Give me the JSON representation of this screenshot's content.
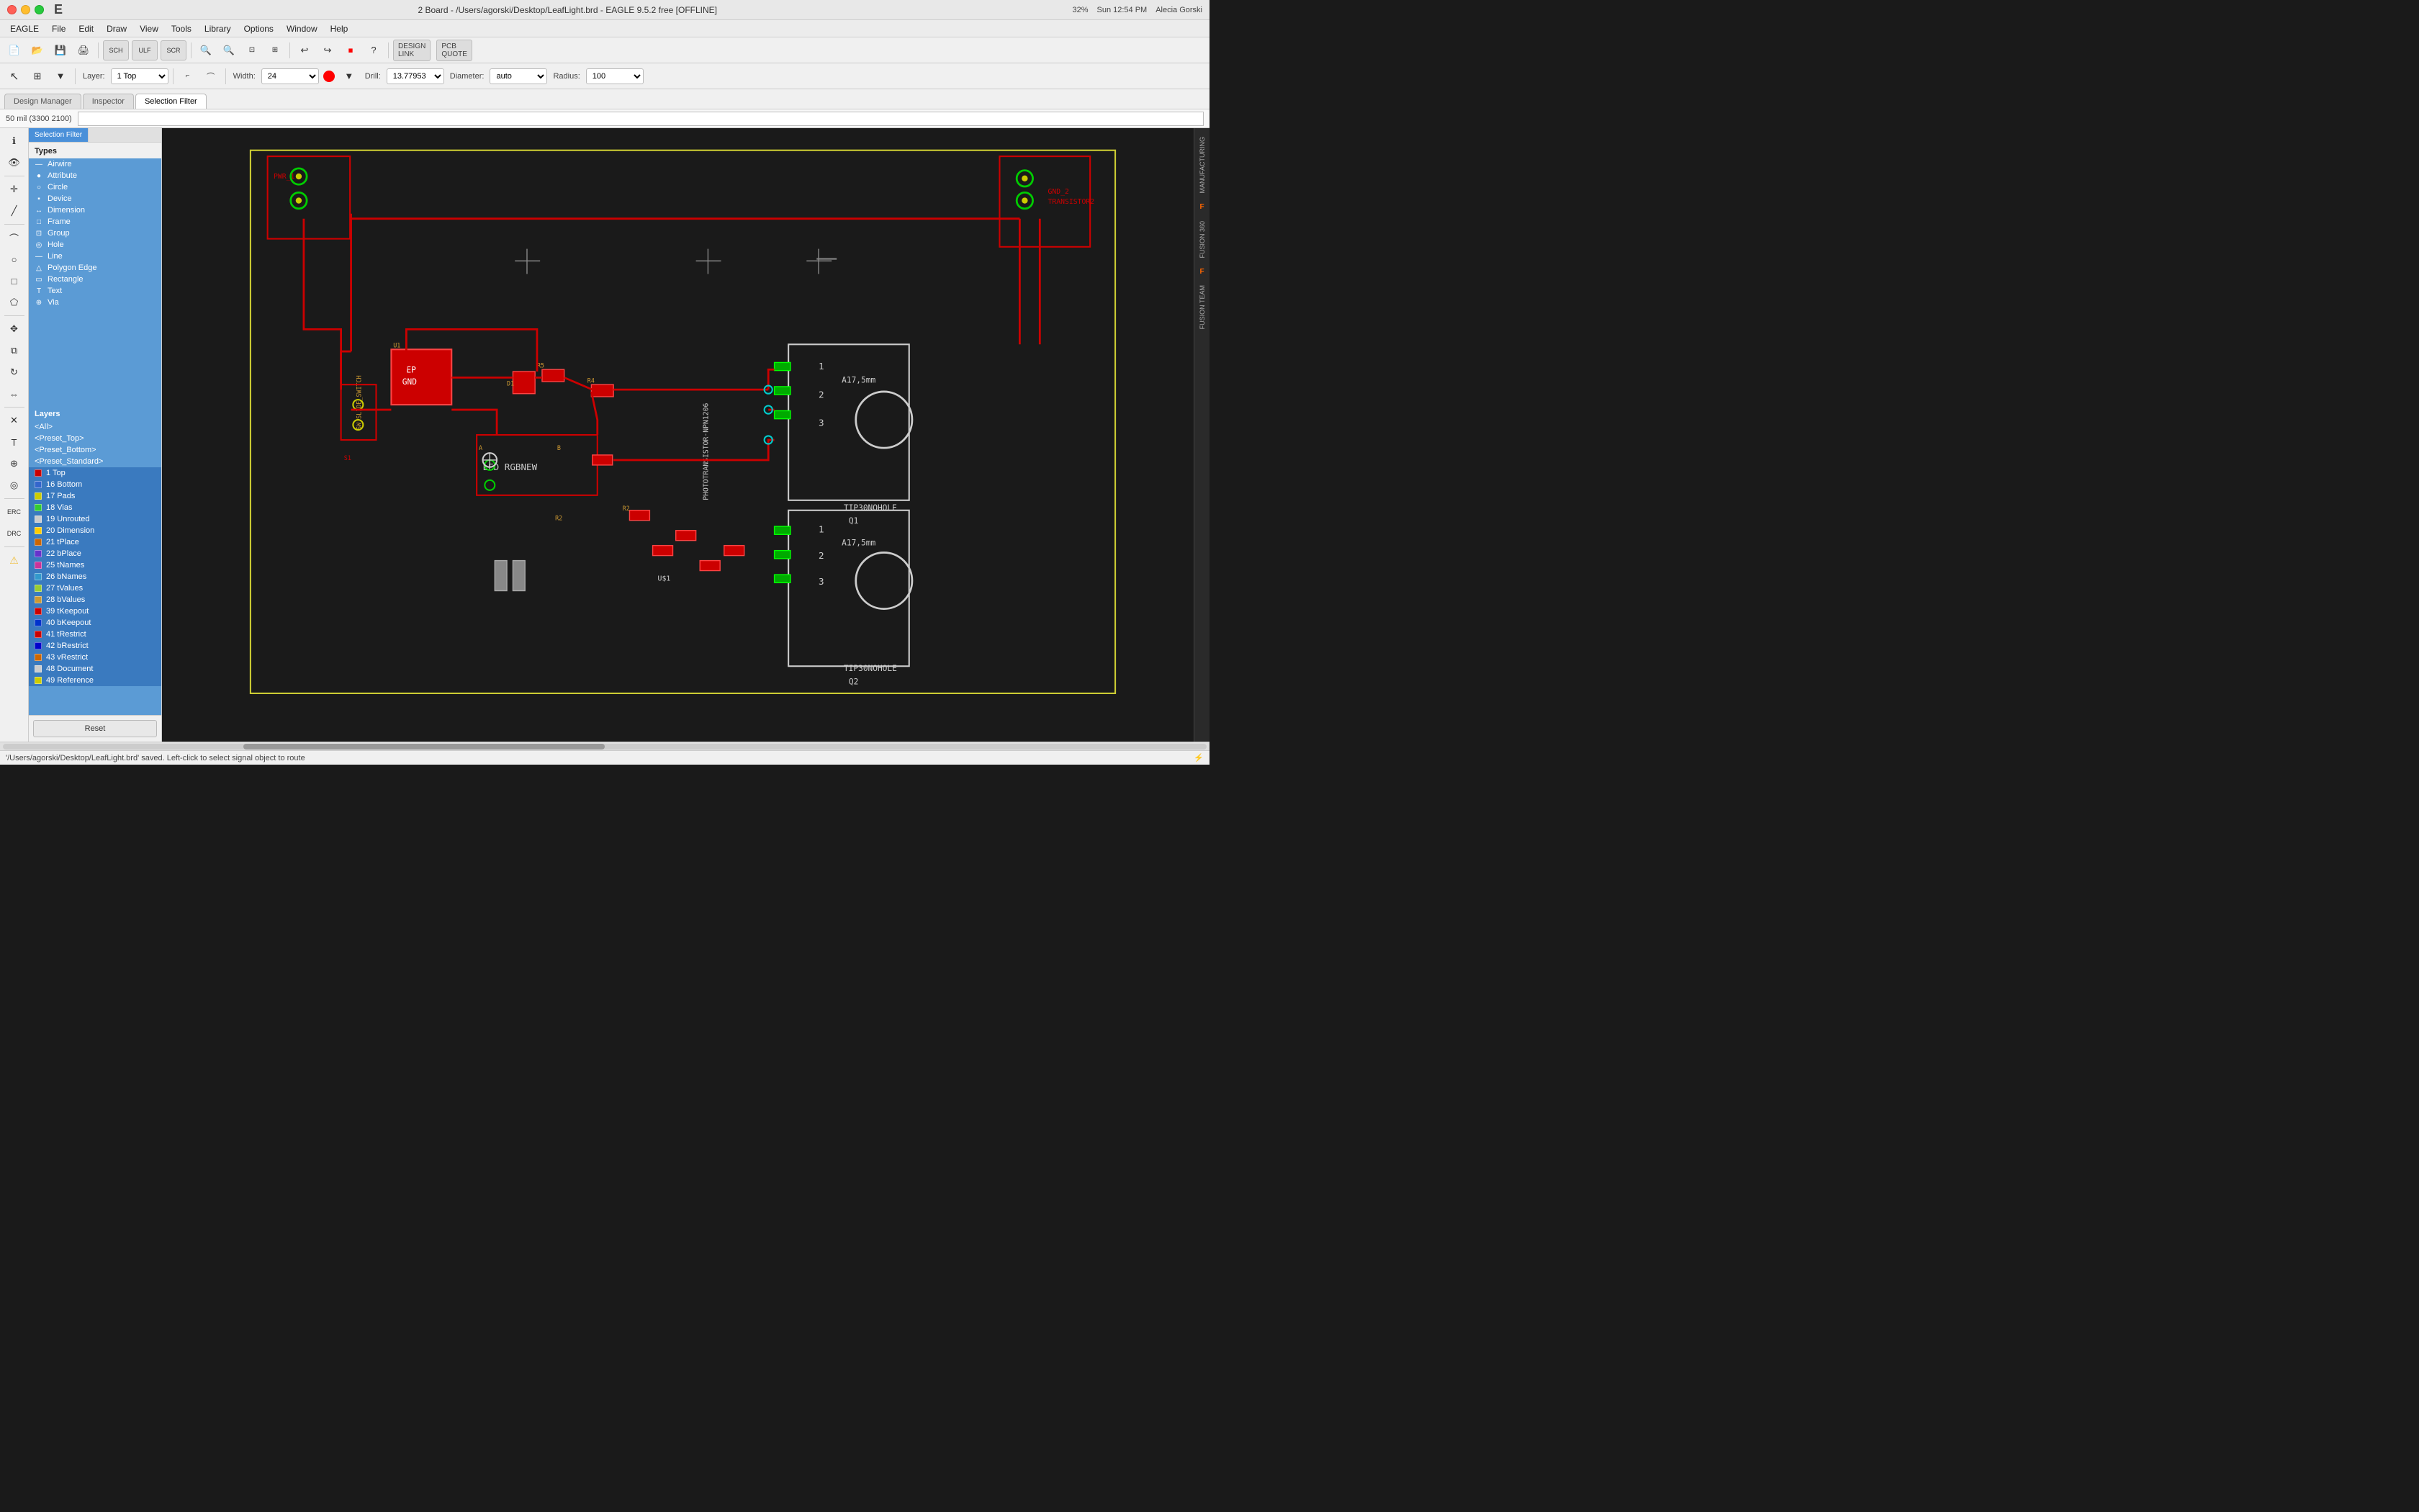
{
  "titlebar": {
    "title": "2 Board - /Users/agorski/Desktop/LeafLight.brd - EAGLE 9.5.2 free [OFFLINE]",
    "right": {
      "battery": "32%",
      "time": "Sun 12:54 PM",
      "user": "Alecia Gorski"
    }
  },
  "menubar": {
    "items": [
      "EAGLE",
      "File",
      "Edit",
      "Draw",
      "View",
      "Tools",
      "Library",
      "Options",
      "Window",
      "Help"
    ]
  },
  "toolbar_main": {
    "layer_label": "Layer:",
    "layer_value": "1 Top",
    "width_label": "Width:",
    "width_value": "24",
    "drill_label": "Drill:",
    "drill_value": "13.77953",
    "diameter_label": "Diameter:",
    "diameter_value": "auto",
    "radius_label": "Radius:",
    "radius_value": "100",
    "design_link": "DESIGN LINK",
    "pcb_quote": "PCB QUOTE"
  },
  "tabs": {
    "design_manager": "Design Manager",
    "inspector": "Inspector",
    "selection_filter": "Selection Filter"
  },
  "coord_bar": {
    "coords": "50 mil (3300 2100)"
  },
  "types": {
    "title": "Types",
    "items": [
      {
        "name": "Airwire",
        "icon": "~"
      },
      {
        "name": "Attribute",
        "icon": "●"
      },
      {
        "name": "Circle",
        "icon": "○"
      },
      {
        "name": "Device",
        "icon": "▪"
      },
      {
        "name": "Dimension",
        "icon": "↔"
      },
      {
        "name": "Frame",
        "icon": "□"
      },
      {
        "name": "Group",
        "icon": "⊡"
      },
      {
        "name": "Hole",
        "icon": "◎"
      },
      {
        "name": "Line",
        "icon": "—"
      },
      {
        "name": "Polygon Edge",
        "icon": "△"
      },
      {
        "name": "Rectangle",
        "icon": "▭"
      },
      {
        "name": "Text",
        "icon": "T"
      },
      {
        "name": "Via",
        "icon": "⊕"
      }
    ]
  },
  "layers": {
    "title": "Layers",
    "presets": [
      "<All>",
      "<Preset_Top>",
      "<Preset_Bottom>",
      "<Preset_Standard>"
    ],
    "items": [
      {
        "num": "1",
        "name": "Top",
        "color": "#cc0000",
        "highlighted": true
      },
      {
        "num": "16",
        "name": "Bottom",
        "color": "#3366cc",
        "highlighted": true
      },
      {
        "num": "17",
        "name": "Pads",
        "color": "#cccc00",
        "highlighted": true
      },
      {
        "num": "18",
        "name": "Vias",
        "color": "#33cc33",
        "highlighted": true
      },
      {
        "num": "19",
        "name": "Unrouted",
        "color": "#cccccc",
        "highlighted": true
      },
      {
        "num": "20",
        "name": "Dimension",
        "color": "#ffcc00",
        "highlighted": true
      },
      {
        "num": "21",
        "name": "tPlace",
        "color": "#cc6600",
        "highlighted": true
      },
      {
        "num": "22",
        "name": "bPlace",
        "color": "#6633cc",
        "highlighted": true
      },
      {
        "num": "25",
        "name": "tNames",
        "color": "#cc3399",
        "highlighted": true
      },
      {
        "num": "26",
        "name": "bNames",
        "color": "#3399cc",
        "highlighted": true
      },
      {
        "num": "27",
        "name": "tValues",
        "color": "#99cc33",
        "highlighted": true
      },
      {
        "num": "28",
        "name": "bValues",
        "color": "#cc9933",
        "highlighted": true
      },
      {
        "num": "39",
        "name": "tKeepout",
        "color": "#cc0000",
        "highlighted": true
      },
      {
        "num": "40",
        "name": "bKeepout",
        "color": "#0033cc",
        "highlighted": true
      },
      {
        "num": "41",
        "name": "tRestrict",
        "color": "#cc0000",
        "highlighted": true
      },
      {
        "num": "42",
        "name": "bRestrict",
        "color": "#0000cc",
        "highlighted": true
      },
      {
        "num": "43",
        "name": "vRestrict",
        "color": "#cc6600",
        "highlighted": true
      },
      {
        "num": "48",
        "name": "Document",
        "color": "#cccccc",
        "highlighted": true
      },
      {
        "num": "49",
        "name": "Reference",
        "color": "#cccc00",
        "highlighted": true
      }
    ]
  },
  "panel_buttons": {
    "reset": "Reset"
  },
  "statusbar": {
    "message": "'/Users/agorski/Desktop/LeafLight.brd' saved. Left-click to select signal object to route",
    "right_icon": "⚡"
  },
  "right_sidebar": {
    "items": [
      "MANUFACTURING",
      "F",
      "FUSION 360",
      "F",
      "FUSION TEAM"
    ]
  }
}
